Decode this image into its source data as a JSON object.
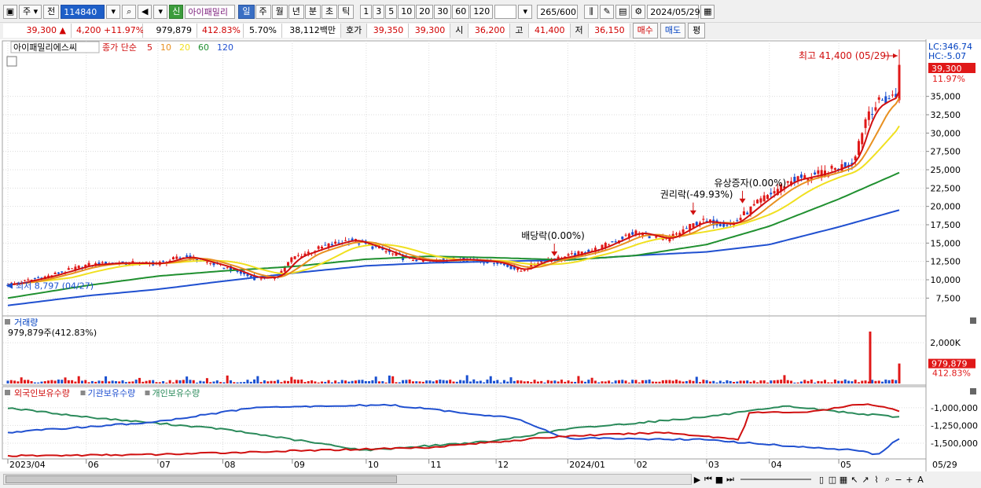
{
  "toolbar": {
    "market": "주",
    "prev_label": "전",
    "code": "114840",
    "tag_new": "신",
    "stock_name": "아이패밀리",
    "periods": [
      "일",
      "주",
      "월",
      "년",
      "분",
      "초",
      "틱"
    ],
    "active_period": "일",
    "intervals": [
      "1",
      "3",
      "5",
      "10",
      "20",
      "30",
      "60",
      "120"
    ],
    "count": "265",
    "count_total": "/600",
    "date": "2024/05/29"
  },
  "quote": {
    "price": "39,300",
    "change": "4,200",
    "change_pct": "+11.97%",
    "volume": "979,879",
    "volume_ratio": "412.83%",
    "turnover_pct": "5.70%",
    "amount": "38,112백만",
    "bid_label": "호가",
    "bid": "39,350",
    "ask": "39,300",
    "open_label": "시",
    "open": "36,200",
    "high_label": "고",
    "high": "41,400",
    "low_label": "저",
    "low": "36,150",
    "buy_label": "매수",
    "sell_label": "매도",
    "eval_label": "평"
  },
  "chart_data": {
    "type": "candlestick",
    "legend_name": "아이패밀리에스씨",
    "ma_label": "종가 단순",
    "ma_periods": [
      "5",
      "10",
      "20",
      "60",
      "120"
    ],
    "ma_colors": [
      "#d01010",
      "#e89020",
      "#f0e020",
      "#209030",
      "#2050d0"
    ],
    "price_ticks": [
      "35,000",
      "32,500",
      "30,000",
      "27,500",
      "25,000",
      "22,500",
      "20,000",
      "17,500",
      "15,000",
      "12,500",
      "10,000",
      "7,500"
    ],
    "price_tick_values": [
      35000,
      32500,
      30000,
      27500,
      25000,
      22500,
      20000,
      17500,
      15000,
      12500,
      10000,
      7500
    ],
    "price_range": [
      5500,
      41500
    ],
    "x_labels": [
      "2023/04",
      "06",
      "07",
      "08",
      "09",
      "10",
      "11",
      "12",
      "2024/01",
      "02",
      "03",
      "04",
      "05"
    ],
    "x_label_dates": [
      "2023-04-27",
      "2023-06-01",
      "2023-07-03",
      "2023-08-01",
      "2023-09-01",
      "2023-10-04",
      "2023-11-01",
      "2023-12-01",
      "2024-01-02",
      "2024-02-01",
      "2024-03-04",
      "2024-04-01",
      "2024-05-02"
    ],
    "last_date_label": "05/29",
    "lc_label": "LC:346.74",
    "hc_label": "HC:-5.07",
    "current_price": "39,300",
    "current_pct": "11.97%",
    "high_annotation": "최고 41,400 (05/29)",
    "low_annotation": "최저 8,797 (04/27)",
    "events": [
      {
        "label": "배당락(0.00%)",
        "date": "2023-12-27",
        "price": 13000
      },
      {
        "label": "권리락(-49.93%)",
        "date": "2024-02-27",
        "price": 18600
      },
      {
        "label": "유상증자(0.00%)",
        "date": "2024-03-20",
        "price": 20200
      }
    ],
    "close_series": [
      {
        "date": "2023-04-27",
        "value": 9300
      },
      {
        "date": "2023-05-15",
        "value": 10500
      },
      {
        "date": "2023-06-01",
        "value": 12000
      },
      {
        "date": "2023-06-15",
        "value": 12300
      },
      {
        "date": "2023-07-03",
        "value": 12200
      },
      {
        "date": "2023-07-15",
        "value": 13200
      },
      {
        "date": "2023-08-01",
        "value": 11800
      },
      {
        "date": "2023-08-15",
        "value": 10200
      },
      {
        "date": "2023-08-25",
        "value": 10400
      },
      {
        "date": "2023-09-01",
        "value": 13000
      },
      {
        "date": "2023-09-15",
        "value": 14500
      },
      {
        "date": "2023-09-27",
        "value": 15500
      },
      {
        "date": "2023-10-10",
        "value": 14200
      },
      {
        "date": "2023-10-20",
        "value": 13000
      },
      {
        "date": "2023-11-01",
        "value": 12500
      },
      {
        "date": "2023-11-15",
        "value": 12800
      },
      {
        "date": "2023-12-01",
        "value": 12400
      },
      {
        "date": "2023-12-12",
        "value": 11200
      },
      {
        "date": "2023-12-20",
        "value": 12500
      },
      {
        "date": "2024-01-02",
        "value": 13200
      },
      {
        "date": "2024-01-15",
        "value": 14200
      },
      {
        "date": "2024-02-01",
        "value": 16500
      },
      {
        "date": "2024-02-15",
        "value": 15500
      },
      {
        "date": "2024-03-01",
        "value": 18000
      },
      {
        "date": "2024-03-15",
        "value": 17500
      },
      {
        "date": "2024-03-29",
        "value": 21000
      },
      {
        "date": "2024-04-10",
        "value": 23500
      },
      {
        "date": "2024-04-25",
        "value": 24500
      },
      {
        "date": "2024-05-08",
        "value": 26000
      },
      {
        "date": "2024-05-15",
        "value": 33000
      },
      {
        "date": "2024-05-22",
        "value": 34500
      },
      {
        "date": "2024-05-28",
        "value": 35100
      },
      {
        "date": "2024-05-29",
        "value": 39300
      }
    ],
    "ma60_series": [
      {
        "date": "2023-04-27",
        "value": 7500
      },
      {
        "date": "2023-06-01",
        "value": 9200
      },
      {
        "date": "2023-07-03",
        "value": 10500
      },
      {
        "date": "2023-08-01",
        "value": 11200
      },
      {
        "date": "2023-09-01",
        "value": 11800
      },
      {
        "date": "2023-10-04",
        "value": 12800
      },
      {
        "date": "2023-11-01",
        "value": 13200
      },
      {
        "date": "2023-12-01",
        "value": 13000
      },
      {
        "date": "2024-01-02",
        "value": 12700
      },
      {
        "date": "2024-02-01",
        "value": 13300
      },
      {
        "date": "2024-03-04",
        "value": 14800
      },
      {
        "date": "2024-04-01",
        "value": 17300
      },
      {
        "date": "2024-05-02",
        "value": 21000
      },
      {
        "date": "2024-05-29",
        "value": 24600
      }
    ],
    "ma120_series": [
      {
        "date": "2023-04-27",
        "value": 6500
      },
      {
        "date": "2023-06-01",
        "value": 7800
      },
      {
        "date": "2023-07-03",
        "value": 8700
      },
      {
        "date": "2023-08-01",
        "value": 9800
      },
      {
        "date": "2023-09-01",
        "value": 10900
      },
      {
        "date": "2023-10-04",
        "value": 11900
      },
      {
        "date": "2023-11-01",
        "value": 12300
      },
      {
        "date": "2023-12-01",
        "value": 12500
      },
      {
        "date": "2024-01-02",
        "value": 12700
      },
      {
        "date": "2024-02-01",
        "value": 13300
      },
      {
        "date": "2024-03-04",
        "value": 13800
      },
      {
        "date": "2024-04-01",
        "value": 14800
      },
      {
        "date": "2024-05-02",
        "value": 17200
      },
      {
        "date": "2024-05-29",
        "value": 19500
      }
    ],
    "volume_panel": {
      "title": "거래량",
      "readout": "979,879주(412.83%)",
      "tick": "2,000K",
      "tick_value": 2000000,
      "max": 2700000,
      "current": "979,879",
      "current_pct": "412.83%",
      "spikes": [
        {
          "date": "2024-05-16",
          "value": 2550000
        },
        {
          "date": "2024-05-29",
          "value": 979879
        }
      ]
    },
    "holding_panel": {
      "series_names": [
        "외국인보유수량",
        "기관보유수량",
        "개인보유수량"
      ],
      "series_colors": [
        "#d01010",
        "#2050d0",
        "#2a8a5a"
      ],
      "ticks": [
        "-1,000,000",
        "-1,250,000",
        "-1,500,000"
      ],
      "tick_values": [
        -1000000,
        -1250000,
        -1500000
      ],
      "range": [
        -1700000,
        -880000
      ],
      "foreign_series": [
        {
          "date": "2023-04-27",
          "value": -1680000
        },
        {
          "date": "2023-07-03",
          "value": -1660000
        },
        {
          "date": "2023-09-01",
          "value": -1610000
        },
        {
          "date": "2023-11-01",
          "value": -1560000
        },
        {
          "date": "2024-01-02",
          "value": -1400000
        },
        {
          "date": "2024-02-15",
          "value": -1350000
        },
        {
          "date": "2024-03-20",
          "value": -1450000
        },
        {
          "date": "2024-03-22",
          "value": -1070000
        },
        {
          "date": "2024-04-20",
          "value": -1060000
        },
        {
          "date": "2024-05-15",
          "value": -940000
        },
        {
          "date": "2024-05-29",
          "value": -1040000
        }
      ],
      "institution_series": [
        {
          "date": "2023-04-27",
          "value": -1350000
        },
        {
          "date": "2023-07-03",
          "value": -1200000
        },
        {
          "date": "2023-08-15",
          "value": -1000000
        },
        {
          "date": "2023-10-15",
          "value": -960000
        },
        {
          "date": "2023-12-10",
          "value": -1150000
        },
        {
          "date": "2024-01-02",
          "value": -1430000
        },
        {
          "date": "2024-03-04",
          "value": -1450000
        },
        {
          "date": "2024-04-01",
          "value": -1520000
        },
        {
          "date": "2024-05-10",
          "value": -1600000
        },
        {
          "date": "2024-05-20",
          "value": -1660000
        },
        {
          "date": "2024-05-29",
          "value": -1450000
        }
      ],
      "individual_series": [
        {
          "date": "2023-04-27",
          "value": -1000000
        },
        {
          "date": "2023-06-01",
          "value": -1130000
        },
        {
          "date": "2023-08-01",
          "value": -1300000
        },
        {
          "date": "2023-10-04",
          "value": -1600000
        },
        {
          "date": "2023-12-01",
          "value": -1470000
        },
        {
          "date": "2024-01-02",
          "value": -1300000
        },
        {
          "date": "2024-03-04",
          "value": -1130000
        },
        {
          "date": "2024-04-10",
          "value": -980000
        },
        {
          "date": "2024-05-10",
          "value": -1080000
        },
        {
          "date": "2024-05-29",
          "value": -1130000
        }
      ]
    }
  }
}
